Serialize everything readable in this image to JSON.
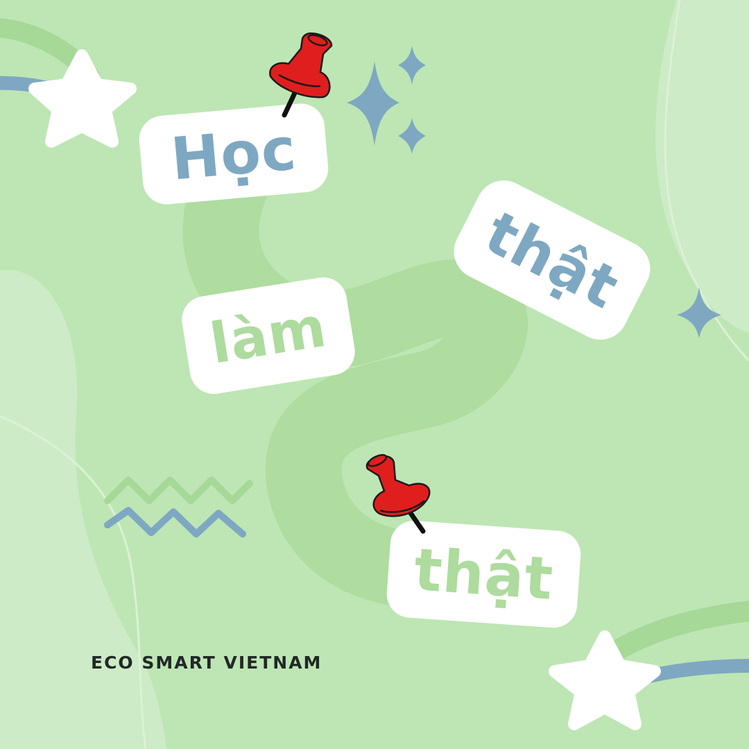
{
  "cards": {
    "hoc": "Học",
    "lam": "làm",
    "that_blue": "thật",
    "that_green": "thật"
  },
  "brand": "ECO SMART VIETNAM",
  "colors": {
    "background": "#bde6b4",
    "path": "#afdc9f",
    "card": "#ffffff",
    "blue_accent": "#7ea8c1",
    "green_accent": "#aedb9e",
    "pin_red": "#e01e1e",
    "text_dark": "#222826"
  },
  "icons": [
    "star-icon",
    "sparkle-icon",
    "pushpin-icon",
    "zigzag-icon"
  ]
}
